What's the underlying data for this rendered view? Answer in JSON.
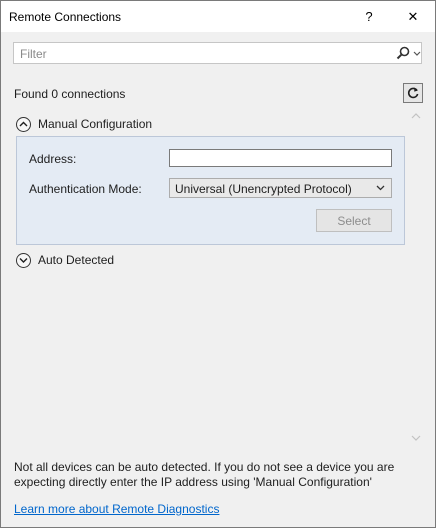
{
  "window": {
    "title": "Remote Connections",
    "help_label": "?",
    "close_label": "✕"
  },
  "filter": {
    "placeholder": "Filter",
    "value": ""
  },
  "status": {
    "found_text": "Found 0 connections"
  },
  "manual": {
    "header": "Manual Configuration",
    "address_label": "Address:",
    "address_value": "",
    "auth_label": "Authentication Mode:",
    "auth_value": "Universal (Unencrypted Protocol)",
    "select_button": "Select"
  },
  "auto": {
    "header": "Auto Detected"
  },
  "footer": {
    "note": "Not all devices can be auto detected. If you do not see a device you are expecting directly enter the IP address using 'Manual Configuration'",
    "link": "Learn more about Remote Diagnostics"
  },
  "colors": {
    "panel_bg": "#e4ebf4",
    "link": "#0066cc",
    "window_bg": "#f0f0f0"
  },
  "icons": [
    "search-icon",
    "chevron-down-icon",
    "refresh-icon",
    "collapse-icon",
    "expand-icon",
    "scroll-up-icon",
    "scroll-down-icon"
  ]
}
